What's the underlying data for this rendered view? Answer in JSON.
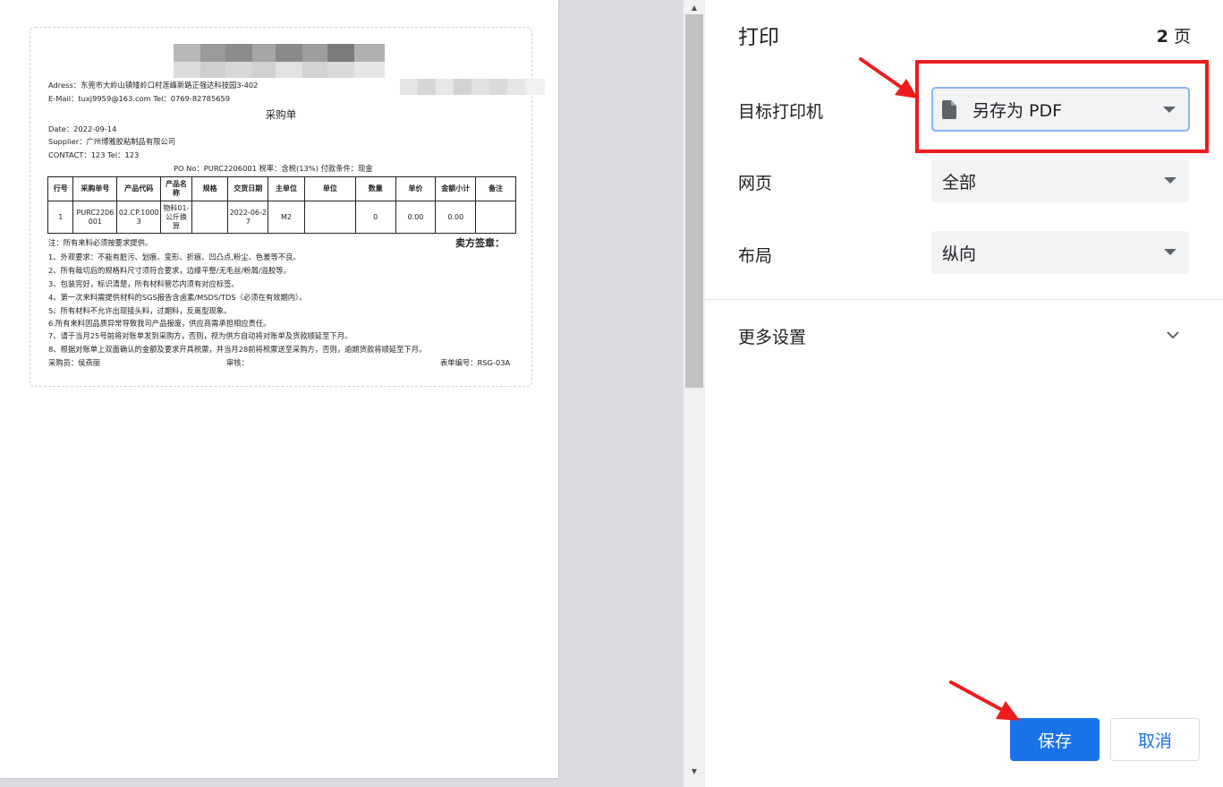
{
  "document": {
    "address": "Adress：东莞市大岭山镇矮岭口村莲峰新路正强达科技园3-402",
    "email_tel": "E-Mail：tuxj9959@163.com      Tel：0769-82785659",
    "title": "采购单",
    "date": "Date：2022-09-14",
    "supplier": "Supplier：广州博雅胶粘制品有限公司",
    "contact": "CONTACT：123      Tel：123",
    "po_line": "PO No：PURC2206001   税率：含税(13%)   付款条件：现金",
    "table": {
      "headers": [
        "行号",
        "采购单号",
        "产品代码",
        "产品名称",
        "规格",
        "交货日期",
        "主单位",
        "单位",
        "数量",
        "单价",
        "金额小计",
        "备注"
      ],
      "rows": [
        [
          "1",
          "PURC2206001",
          "02.CP.10003",
          "物料01-公斤换算",
          "",
          "2022-06-27",
          "M2",
          "",
          "0",
          "0.00",
          "0.00",
          ""
        ]
      ]
    },
    "note": "注：所有来料必须按要求提供。",
    "seller_sign": "卖方签章：",
    "terms": [
      "1、外观要求：不能有脏污、划痕、变形、折痕、凹凸点,粉尘、色差等不良。",
      "2、所有裁切后的规格料尺寸须符合要求，边缘平整/无毛丝/粉屑/溢胶等。",
      "3、包装完好，标识清楚，所有材料管芯内须有对应标签。",
      "4、第一次来料需提供材料的SGS报告含卤素/MSDS/TDS（必须在有效期内）。",
      "5、所有材料不允许出现接头料，过期料，反离型现象。",
      "6.所有来料因品质异常导致我司产品报废，供应商需承担相应责任。",
      "7、请于当月25号前将对账单发到采购方，否则，视为供方自动将对账单及货款顺延至下月。",
      "8、根据对账单上双面确认的金额及要求开具税票，并当月28前将税票送至采购方，否则，逾期货款将顺延至下月。"
    ],
    "buyer": "采购员：侯燕丽",
    "reviewer": "审核：",
    "form_no": "表单编号：RSG-03A"
  },
  "panel": {
    "title": "打印",
    "page_count_number": "2",
    "page_count_unit": "页",
    "destination_label": "目标打印机",
    "destination_value": "另存为 PDF",
    "pages_label": "网页",
    "pages_value": "全部",
    "layout_label": "布局",
    "layout_value": "纵向",
    "more_settings_label": "更多设置",
    "save_label": "保存",
    "cancel_label": "取消"
  },
  "colors": {
    "accent": "#1a73e8",
    "annotation_red": "#ee1c1c",
    "focus_ring": "#8ab4f8"
  }
}
